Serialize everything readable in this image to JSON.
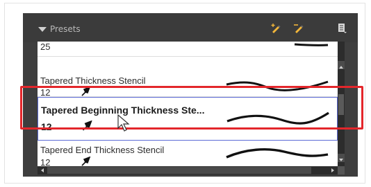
{
  "panel": {
    "title": "Presets",
    "icons": [
      "new-preset-icon",
      "rename-preset-icon",
      "presets-menu-icon"
    ]
  },
  "rows": [
    {
      "name": "",
      "size": "25"
    },
    {
      "name": "Tapered Thickness Stencil",
      "size": "12"
    },
    {
      "name": "Tapered Beginning Thickness Ste...",
      "size": "12",
      "selected": true
    },
    {
      "name": "Tapered End Thickness Stencil",
      "size": "12"
    }
  ],
  "colors": {
    "highlight": "#e3262b",
    "selection_border": "#5b6ad6",
    "panel_bg": "#3e3e3e"
  }
}
